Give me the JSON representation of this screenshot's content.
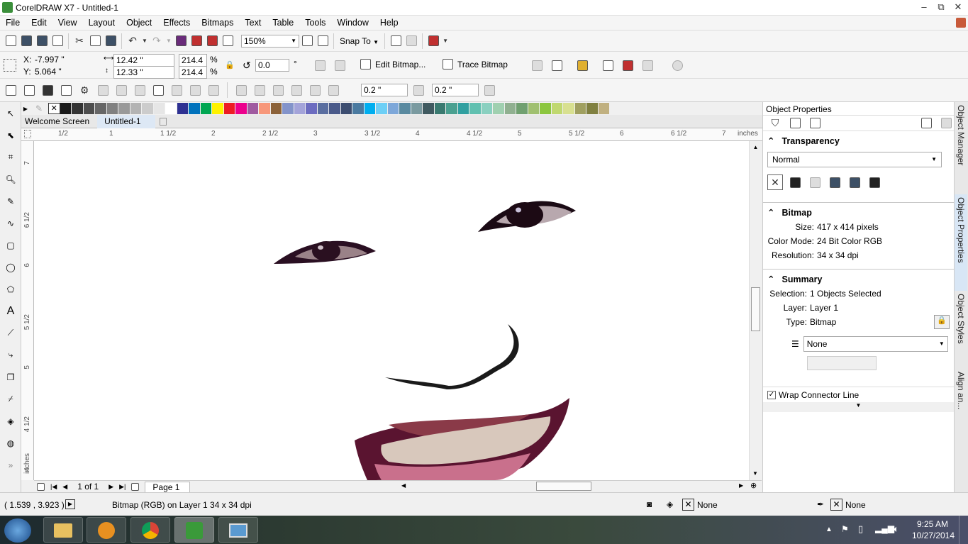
{
  "window": {
    "title": "CorelDRAW X7 - Untitled-1",
    "min": "–",
    "max": "⧉",
    "close": "✕"
  },
  "menu": [
    "File",
    "Edit",
    "View",
    "Layout",
    "Object",
    "Effects",
    "Bitmaps",
    "Text",
    "Table",
    "Tools",
    "Window",
    "Help"
  ],
  "standard": {
    "zoom": "150%",
    "snap_to": "Snap To"
  },
  "props": {
    "x": "-7.997 \"",
    "y": "5.064 \"",
    "w": "12.42 \"",
    "h": "12.33 \"",
    "sx": "214.4",
    "sy": "214.4",
    "pct1": "%",
    "pct2": "%",
    "angle": "0.0",
    "deg": "°",
    "edit_bitmap": "Edit Bitmap...",
    "trace_bitmap": "Trace Bitmap",
    "x_label": "X:",
    "y_label": "Y:"
  },
  "fx": {
    "outline1": "0.2 \"",
    "outline2": "0.2 \""
  },
  "palette": [
    "#ffffff",
    "#1a1a1a",
    "#333333",
    "#4d4d4d",
    "#666666",
    "#808080",
    "#999999",
    "#b3b3b3",
    "#cccccc",
    "#e6e6e6",
    "#ffffff",
    "#2e3192",
    "#0072bc",
    "#00a651",
    "#fff200",
    "#ed1c24",
    "#ec008c",
    "#a05aa0",
    "#f7977a",
    "#8c6239",
    "#8393ca",
    "#a3a3d9",
    "#6c6cc0",
    "#5a6ea0",
    "#4a5a8a",
    "#3c4d70",
    "#4a7aa0",
    "#00aeef",
    "#6dcff6",
    "#7da7d9",
    "#5a8aa0",
    "#7a9aa0",
    "#405a60",
    "#3a7a70",
    "#4aa090",
    "#30a0a0",
    "#60c0b0",
    "#8ad0c0",
    "#a0d0b0",
    "#90b090",
    "#70a070",
    "#a0c070",
    "#8cc63f",
    "#c0d870",
    "#d8e090",
    "#a0a060",
    "#808040",
    "#c0b080"
  ],
  "doctabs": {
    "welcome": "Welcome Screen",
    "doc": "Untitled-1"
  },
  "ruler": {
    "units": "inches",
    "h_ticks": [
      "1/2",
      "1",
      "1 1/2",
      "2",
      "2 1/2",
      "3",
      "3 1/2",
      "4",
      "4 1/2",
      "5",
      "5 1/2",
      "6",
      "6 1/2",
      "7"
    ],
    "v_ticks": [
      "7",
      "6 1/2",
      "6",
      "5 1/2",
      "5",
      "4 1/2",
      "4"
    ],
    "v_units": "inches"
  },
  "pages": {
    "count": "1 of 1",
    "page_tab": "Page 1"
  },
  "docker": {
    "title": "Object Properties",
    "transparency": {
      "heading": "Transparency",
      "mode": "Normal"
    },
    "bitmap": {
      "heading": "Bitmap",
      "size_k": "Size:",
      "size_v": "417 x 414 pixels",
      "mode_k": "Color Mode:",
      "mode_v": "24 Bit Color  RGB",
      "res_k": "Resolution:",
      "res_v": "34 x 34 dpi"
    },
    "summary": {
      "heading": "Summary",
      "sel_k": "Selection:",
      "sel_v": "1 Objects Selected",
      "layer_k": "Layer:",
      "layer_v": "Layer 1",
      "type_k": "Type:",
      "type_v": "Bitmap"
    },
    "none_select": "None",
    "wrap_label": "Wrap Connector Line",
    "vtabs": [
      "Object Manager",
      "Object Properties",
      "Object Styles",
      "Align an..."
    ]
  },
  "status": {
    "coords": "( 1.539 , 3.923  )",
    "info": "Bitmap (RGB) on Layer 1 34 x 34 dpi",
    "fill": "None",
    "outline": "None"
  },
  "taskbar": {
    "time": "9:25 AM",
    "date": "10/27/2014"
  }
}
